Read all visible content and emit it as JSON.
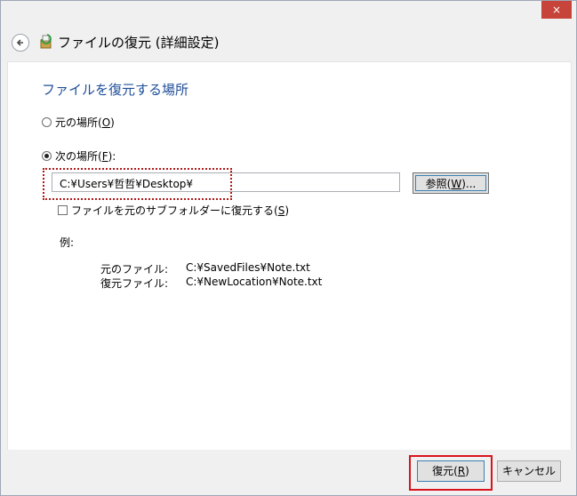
{
  "window": {
    "close_label": "×"
  },
  "header": {
    "title": "ファイルの復元 (詳細設定)"
  },
  "content": {
    "section_title": "ファイルを復元する場所",
    "option_original": {
      "label": "元の場所(",
      "key": "O",
      "tail": ")"
    },
    "option_other": {
      "label": "次の場所(",
      "key": "F",
      "tail": "):"
    },
    "path_value": "C:¥Users¥哲哲¥Desktop¥",
    "browse": {
      "label": "参照(",
      "key": "W",
      "tail": ")..."
    },
    "subfolder_checkbox": {
      "label": "ファイルを元のサブフォルダーに復元する(",
      "key": "S",
      "tail": ")"
    },
    "example_label": "例:",
    "example_rows": [
      {
        "key": "元のファイル:",
        "value": "C:¥SavedFiles¥Note.txt"
      },
      {
        "key": "復元ファイル:",
        "value": "C:¥NewLocation¥Note.txt"
      }
    ]
  },
  "footer": {
    "restore": {
      "label": "復元(",
      "key": "R",
      "tail": ")"
    },
    "cancel_label": "キャンセル"
  }
}
